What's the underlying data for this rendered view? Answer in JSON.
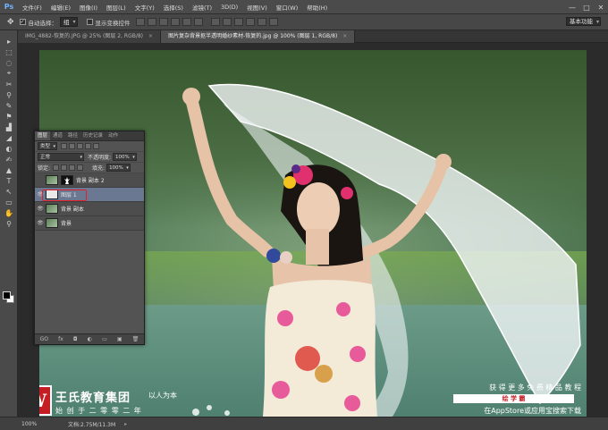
{
  "app": {
    "logo": "Ps",
    "menu": [
      "文件(F)",
      "编辑(E)",
      "图像(I)",
      "图层(L)",
      "文字(Y)",
      "选择(S)",
      "滤镜(T)",
      "3D(D)",
      "视图(V)",
      "窗口(W)",
      "帮助(H)"
    ],
    "window_controls": [
      "—",
      "□",
      "✕"
    ]
  },
  "options": {
    "auto_select_label": "自动选择：",
    "auto_select_value": "组",
    "show_transform_label": "显示变换控件",
    "workspace": "基本功能"
  },
  "tabs": [
    {
      "label": "IMG_4882-恢复的.JPG @ 25% (图层 2, RGB/8)",
      "close": "×",
      "active": false
    },
    {
      "label": "图片复杂背景抠半透明婚纱素材-恢复的.jpg @ 100% (图层 1, RGB/8)",
      "close": "×",
      "active": true
    }
  ],
  "tools": [
    "▸",
    "⬚",
    "◌",
    "⌖",
    "✂",
    "⚲",
    "✎",
    "⚑",
    "▟",
    "◢",
    "◐",
    "✍",
    "▲",
    "T",
    "↖",
    "▭",
    "✋",
    "⚲"
  ],
  "layers_panel": {
    "tabs": [
      "图层",
      "通道",
      "路径",
      "历史记录",
      "动作"
    ],
    "filter_label": "类型",
    "blend_mode": "正常",
    "opacity_label": "不透明度:",
    "opacity_value": "100%",
    "lock_label": "锁定:",
    "fill_label": "填充:",
    "fill_value": "100%",
    "layers": [
      {
        "name": "背景 副本 2",
        "visible": "",
        "selected": false,
        "thumb": "photo",
        "mask": true
      },
      {
        "name": "图层 1",
        "visible": "👁",
        "selected": true,
        "thumb": "white",
        "mask": false
      },
      {
        "name": "背景 副本",
        "visible": "👁",
        "selected": false,
        "thumb": "photo",
        "mask": false
      },
      {
        "name": "背景",
        "visible": "👁",
        "selected": false,
        "thumb": "photo",
        "mask": false
      }
    ],
    "footer_icons": [
      "GO",
      "fx",
      "◘",
      "◐",
      "▭",
      "▣",
      "🗑"
    ]
  },
  "brand": {
    "logo_letter": "W",
    "company": "王氏教育集团",
    "slogan": "以人为本",
    "founded": "始 创 于 二 零 零 二 年",
    "promo_line1": "获 得 更 多 免 费 精 品 教 程",
    "promo_app": "绘 学 霸",
    "promo_line3": "在AppStore或应用宝搜索下载"
  },
  "status": {
    "zoom": "100%",
    "doc": "文档:2.75M/11.3M",
    "arrow": "▸"
  }
}
